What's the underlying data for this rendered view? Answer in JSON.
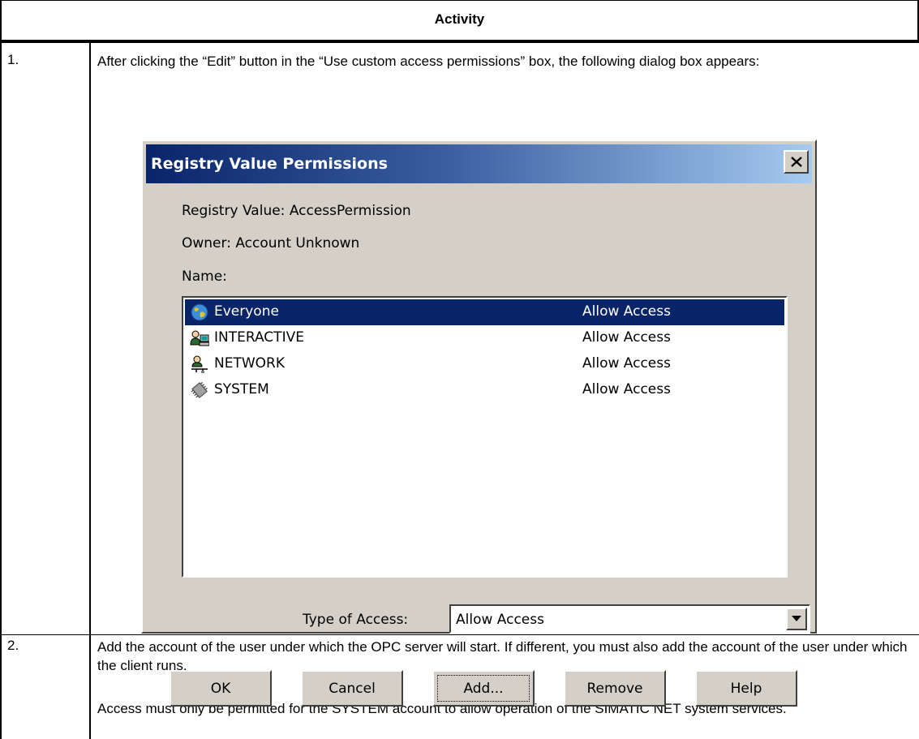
{
  "table": {
    "header": "Activity",
    "steps": [
      {
        "number": "1.",
        "text": "After clicking the “Edit” button in the “Use custom access permissions” box, the following dialog box appears:"
      },
      {
        "number": "2.",
        "paragraphs": [
          "Add the account of the user under which the OPC server will start. If different, you must also add the account of the user under which the client runs.",
          "Access must only be permitted for the SYSTEM account to allow operation of the SIMATIC NET system services."
        ]
      }
    ]
  },
  "dialog": {
    "title": "Registry Value Permissions",
    "registry_value": "Registry Value:   AccessPermission",
    "owner": "Owner:  Account Unknown",
    "name_label": "Name:",
    "entries": [
      {
        "name": "Everyone",
        "access": "Allow Access",
        "icon": "globe-icon",
        "selected": true
      },
      {
        "name": "INTERACTIVE",
        "access": "Allow Access",
        "icon": "interactive-user-icon",
        "selected": false
      },
      {
        "name": "NETWORK",
        "access": "Allow Access",
        "icon": "network-user-icon",
        "selected": false
      },
      {
        "name": "SYSTEM",
        "access": "Allow Access",
        "icon": "system-chip-icon",
        "selected": false
      }
    ],
    "type_of_access_label": "Type of Access:",
    "type_of_access_value": "Allow Access",
    "buttons": {
      "ok": "OK",
      "cancel": "Cancel",
      "add": "Add...",
      "remove": "Remove",
      "help": "Help"
    },
    "colors": {
      "face": "#d4d0c8",
      "selection": "#0a246a",
      "title_start": "#0a246a",
      "title_end": "#a6caf0"
    }
  }
}
